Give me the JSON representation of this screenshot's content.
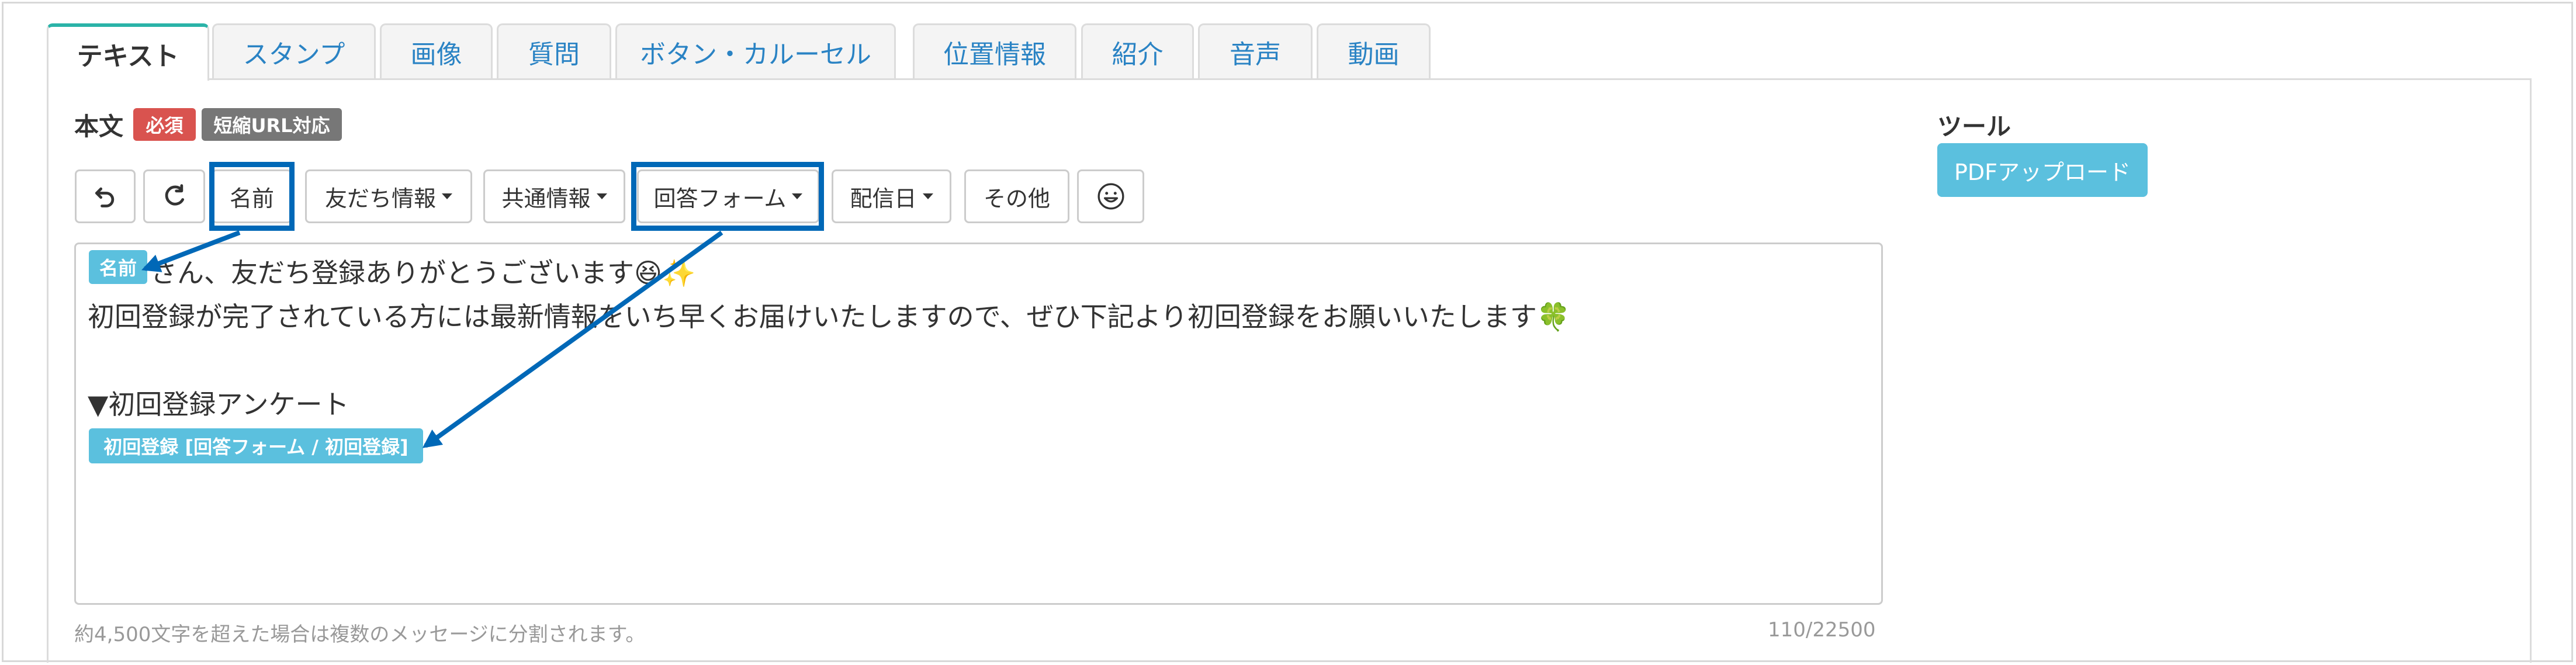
{
  "tabs": [
    {
      "label": "テキスト"
    },
    {
      "label": "スタンプ"
    },
    {
      "label": "画像"
    },
    {
      "label": "質問"
    },
    {
      "label": "ボタン・カルーセル"
    },
    {
      "label": "位置情報"
    },
    {
      "label": "紹介"
    },
    {
      "label": "音声"
    },
    {
      "label": "動画"
    }
  ],
  "body_section": {
    "label": "本文",
    "required_badge": "必須",
    "short_url_badge": "短縮URL対応"
  },
  "toolbar": {
    "name_label": "名前",
    "friend_info_label": "友だち情報",
    "shared_info_label": "共通情報",
    "answer_form_label": "回答フォーム",
    "delivery_date_label": "配信日",
    "other_label": "その他"
  },
  "editor": {
    "name_tag": "名前",
    "line1": "さん、友だち登録ありがとうございます😆✨",
    "line2": "初回登録が完了されている方には最新情報をいち早くお届けいたしますので、ぜひ下記より初回登録をお願いいたします🍀",
    "line3": "▼初回登録アンケート",
    "form_tag": "初回登録 [回答フォーム / 初回登録]"
  },
  "footer": {
    "notice": "約4,500文字を超えた場合は複数のメッセージに分割されます。",
    "char_count": "110/22500"
  },
  "tools": {
    "label": "ツール",
    "pdf_upload_label": "PDFアップロード"
  },
  "colors": {
    "required_badge": "#d9534f",
    "short_url_badge": "#777777",
    "info_tag": "#5bc0de",
    "highlight": "#0068b7"
  }
}
